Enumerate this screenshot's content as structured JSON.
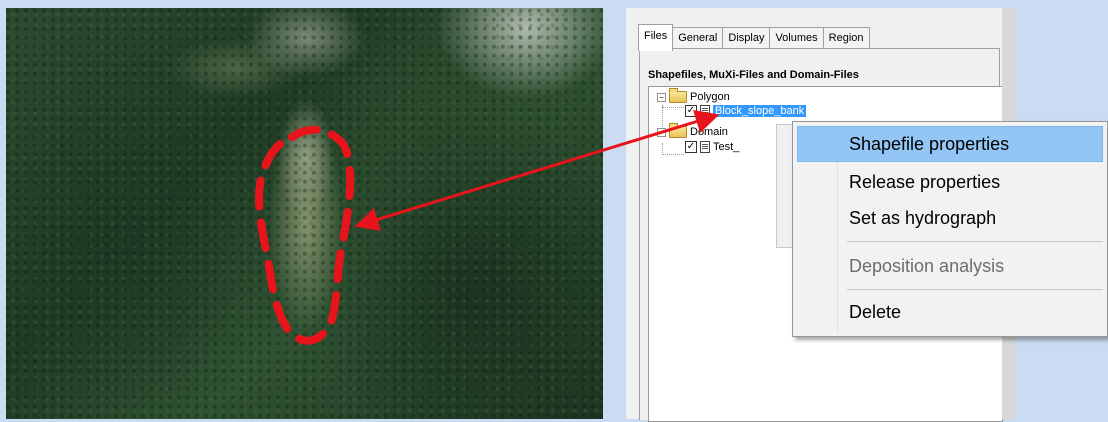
{
  "tabs": [
    {
      "label": "Files",
      "active": true
    },
    {
      "label": "General",
      "active": false
    },
    {
      "label": "Display",
      "active": false
    },
    {
      "label": "Volumes",
      "active": false
    },
    {
      "label": "Region",
      "active": false
    }
  ],
  "files_heading": "Shapefiles, MuXi-Files and Domain-Files",
  "tree": {
    "polygon_folder": "Polygon",
    "polygon_file": "Block_slope_bank",
    "polygon_file_checked": true,
    "domain_folder": "Domain",
    "domain_file": "Test_",
    "domain_file_checked": true
  },
  "context_menu": {
    "items": [
      {
        "label": "Shapefile properties",
        "highlighted": true,
        "enabled": true
      },
      {
        "label": "Release properties",
        "highlighted": false,
        "enabled": true
      },
      {
        "label": "Set as hydrograph",
        "highlighted": false,
        "enabled": true
      },
      {
        "label": "Deposition analysis",
        "highlighted": false,
        "enabled": false
      },
      {
        "label": "Delete",
        "highlighted": false,
        "enabled": true
      }
    ]
  },
  "colors": {
    "annotation_red": "#e8141b",
    "selection_blue": "#3399ff",
    "menu_highlight": "#93c6f5",
    "background": "#c9dcf1"
  }
}
